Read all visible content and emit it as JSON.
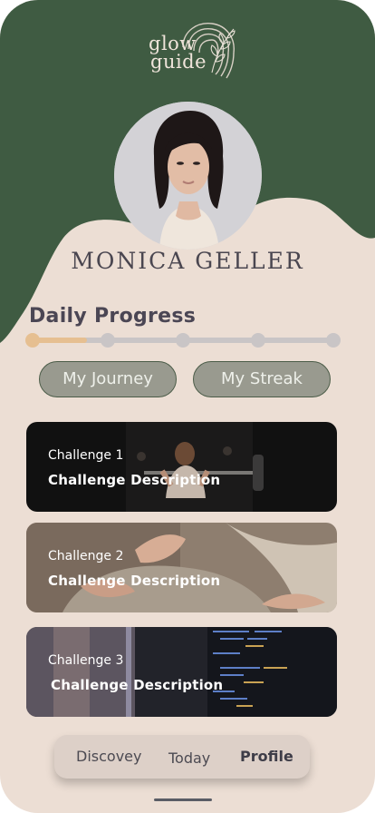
{
  "brand": {
    "logo_line1": "glow",
    "logo_line2": "guide"
  },
  "profile": {
    "name": "MONICA GELLER"
  },
  "progress": {
    "title": "Daily Progress",
    "steps_total": 5,
    "steps_completed": 1,
    "fill_fraction": 0.18
  },
  "actions": {
    "journey_label": "My Journey",
    "streak_label": "My Streak"
  },
  "challenges": [
    {
      "title": "Challenge 1",
      "description": "Challenge Description"
    },
    {
      "title": "Challenge 2",
      "description": "Challenge Description"
    },
    {
      "title": "Challenge 3",
      "description": "Challenge Description"
    }
  ],
  "nav": {
    "discovery_label": "Discovey",
    "today_label": "Today",
    "profile_label": "Profile",
    "active": "Profile"
  },
  "colors": {
    "header_green": "#3f5b42",
    "background": "#ecded4",
    "progress_accent": "#e6bf91",
    "progress_track": "#c9c5c6",
    "pill_fill": "#999a8f"
  }
}
